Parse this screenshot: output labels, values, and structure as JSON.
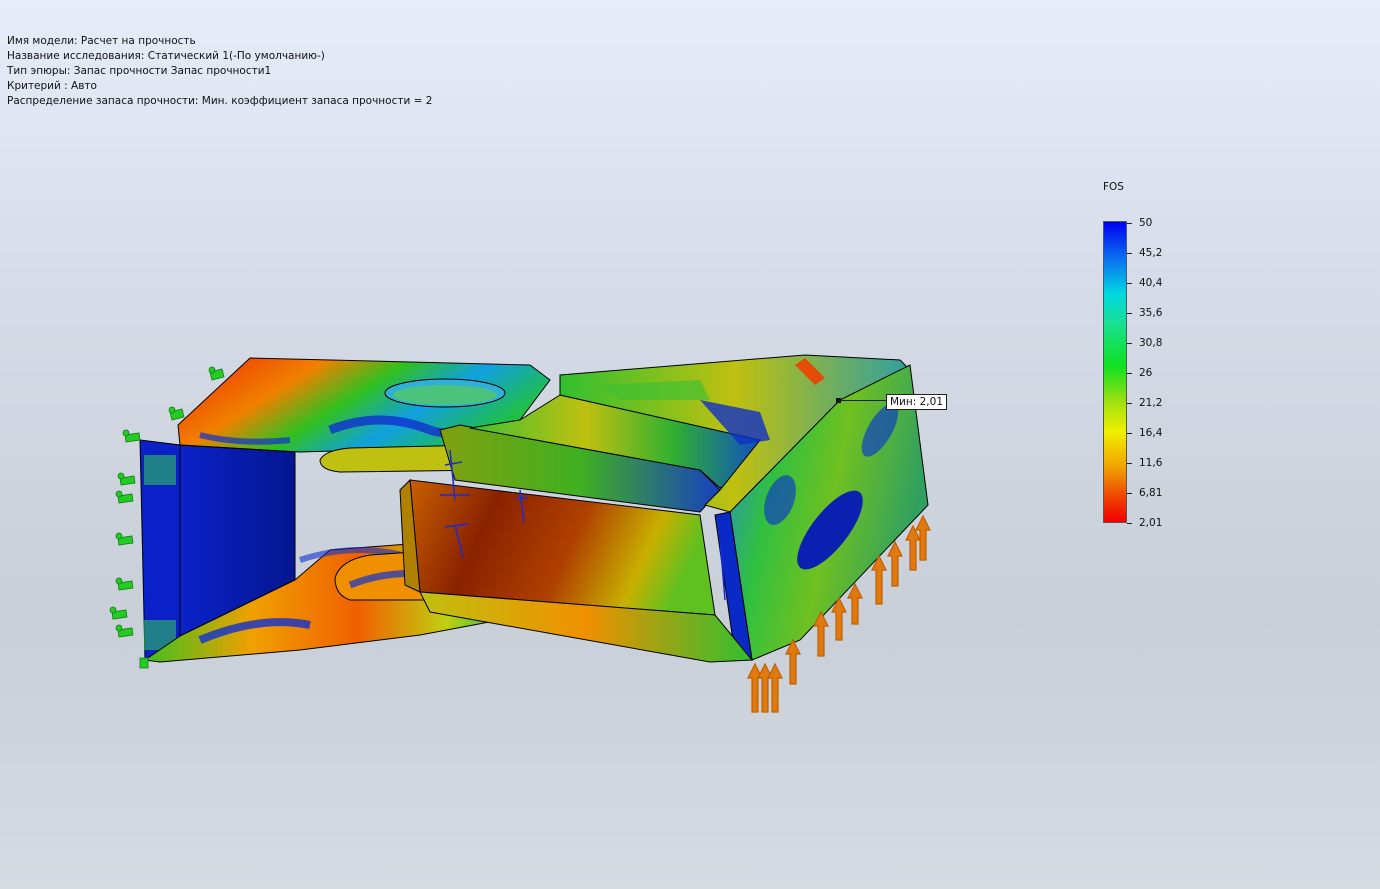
{
  "info": {
    "model_name": "Имя модели: Расчет на прочность",
    "study_name": "Название исследования: Статический 1(-По умолчанию-)",
    "plot_type": "Тип эпюры: Запас прочности Запас прочности1",
    "criterion": "Критерий : Авто",
    "fos_distribution": "Распределение запаса прочности: Мин. коэффициент запаса прочности = 2"
  },
  "legend": {
    "title": "FOS",
    "ticks": [
      "50",
      "45,2",
      "40,4",
      "35,6",
      "30,8",
      "26",
      "21,2",
      "16,4",
      "11,6",
      "6,81",
      "2,01"
    ],
    "max_value": 50,
    "min_value": 2.01
  },
  "probe": {
    "label": "Мин: 2,01",
    "value": 2.01
  },
  "colors": {
    "fixture_arrows": "#22cc22",
    "load_arrows": "#e07a10",
    "bearing_markers": "#1a2ad8",
    "model_outline": "#000000"
  }
}
